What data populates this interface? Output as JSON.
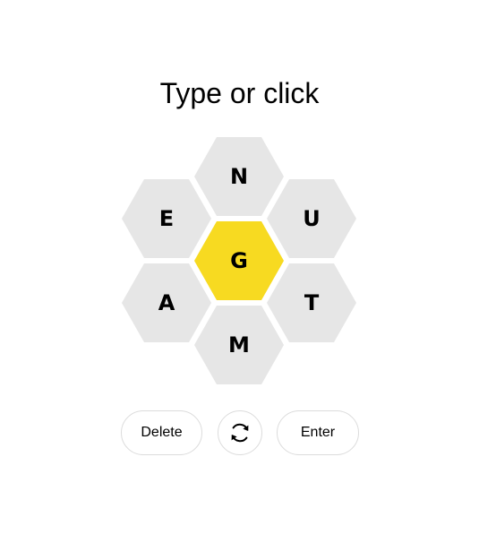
{
  "prompt": "Type or click",
  "hive": {
    "center_letter": "G",
    "outer_letters": {
      "top": "N",
      "upper_left": "E",
      "upper_right": "U",
      "lower_left": "A",
      "lower_right": "T",
      "bottom": "M"
    }
  },
  "controls": {
    "delete_label": "Delete",
    "shuffle_icon": "shuffle-icon",
    "enter_label": "Enter"
  },
  "colors": {
    "center_fill": "#f7da21",
    "outer_fill": "#e6e6e6",
    "text": "#000000"
  }
}
